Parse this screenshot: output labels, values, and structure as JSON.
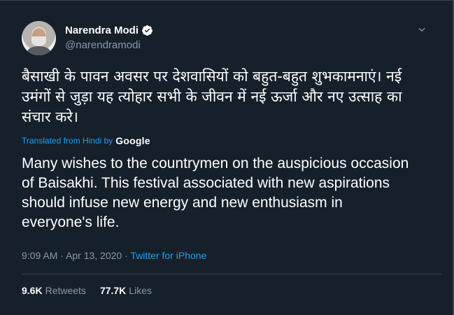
{
  "author": {
    "name": "Narendra Modi",
    "handle": "@narendramodi"
  },
  "tweet": {
    "original_text": "बैसाखी के पावन अवसर पर देशवासियों को बहुत-बहुत शुभकामनाएं। नई उमंगों से जुड़ा यह त्योहार सभी के जीवन में नई ऊर्जा और नए उत्साह का संचार करे।",
    "translated_label": "Translated from Hindi by",
    "translator": "Google",
    "translated_text": "Many wishes to the countrymen on the auspicious occasion of Baisakhi. This festival associated with new aspirations should infuse new energy and new enthusiasm in everyone's life.",
    "time": "9:09 AM",
    "date": "Apr 13, 2020",
    "separator": "·",
    "source": "Twitter for iPhone"
  },
  "stats": {
    "retweets_count": "9.6K",
    "retweets_label": "Retweets",
    "likes_count": "77.7K",
    "likes_label": "Likes"
  },
  "colors": {
    "background": "#15202b",
    "accent": "#1da1f2",
    "muted": "#8899a6",
    "divider": "#38444d"
  },
  "icons": {
    "verified": "verified-badge-icon",
    "caret": "chevron-down-icon"
  }
}
